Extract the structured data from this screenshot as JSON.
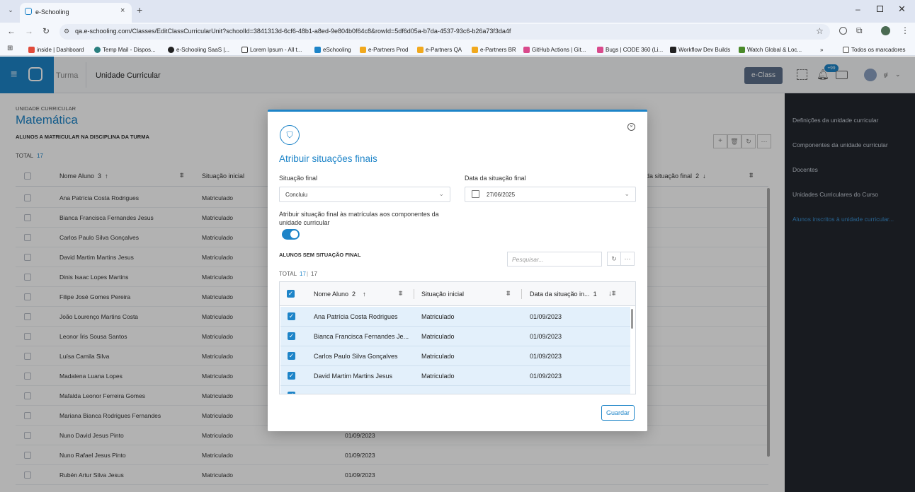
{
  "browser": {
    "tab_title": "e-Schooling",
    "url": "qa.e-schooling.com/Classes/EditClassCurricularUnit?schoolId=3841313d-6cf6-48b1-a8ed-9e804b0f64c8&rowId=5df6d05a-b7da-4537-93c6-b26a73f3da4f",
    "bookmarks": [
      "inside | Dashboard",
      "Temp Mail - Dispos...",
      "e-Schooling SaaS |...",
      "Lorem Ipsum - All t...",
      "eSchooling",
      "e-Partners Prod",
      "e-Partners QA",
      "e-Partners BR",
      "GitHub Actions | Git...",
      "Bugs | CODE 360 (Li...",
      "Workflow Dev Builds",
      "Watch Global & Loc..."
    ],
    "bookmarks_more": "»",
    "all_bookmarks": "Todos os marcadores"
  },
  "header": {
    "breadcrumb_1": "Turma",
    "breadcrumb_2": "Unidade Curricular",
    "eclass_button": "e-Class",
    "notif_badge": "+99",
    "user_initials": "gl"
  },
  "page": {
    "section_label": "UNIDADE CURRICULAR",
    "title": "Matemática",
    "subtitle": "ALUNOS A MATRICULAR NA DISCIPLINA DA TURMA",
    "total_label": "TOTAL",
    "total_value": "17",
    "col_name": "Nome Aluno",
    "col_name_order": "3",
    "col_situation": "Situação inicial",
    "col_date": "da situação final",
    "col_date_order": "2",
    "rows": [
      {
        "name": "Ana Patrícia Costa Rodrigues",
        "situation": "Matriculado",
        "date": ""
      },
      {
        "name": "Bianca Francisca Fernandes Jesus",
        "situation": "Matriculado",
        "date": ""
      },
      {
        "name": "Carlos Paulo Silva Gonçalves",
        "situation": "Matriculado",
        "date": ""
      },
      {
        "name": "David Martim Martins Jesus",
        "situation": "Matriculado",
        "date": ""
      },
      {
        "name": "Dinis Isaac Lopes Martins",
        "situation": "Matriculado",
        "date": ""
      },
      {
        "name": "Filipe José Gomes Pereira",
        "situation": "Matriculado",
        "date": ""
      },
      {
        "name": "João Lourenço Martins Costa",
        "situation": "Matriculado",
        "date": ""
      },
      {
        "name": "Leonor Íris Sousa Santos",
        "situation": "Matriculado",
        "date": ""
      },
      {
        "name": "Luísa Camila Silva",
        "situation": "Matriculado",
        "date": ""
      },
      {
        "name": "Madalena Luana Lopes",
        "situation": "Matriculado",
        "date": ""
      },
      {
        "name": "Mafalda Leonor Ferreira Gomes",
        "situation": "Matriculado",
        "date": ""
      },
      {
        "name": "Mariana Bianca Rodrigues Fernandes",
        "situation": "Matriculado",
        "date": ""
      },
      {
        "name": "Nuno David Jesus Pinto",
        "situation": "Matriculado",
        "date": "01/09/2023"
      },
      {
        "name": "Nuno Rafael Jesus Pinto",
        "situation": "Matriculado",
        "date": "01/09/2023"
      },
      {
        "name": "Rubén Artur Silva Jesus",
        "situation": "Matriculado",
        "date": "01/09/2023"
      }
    ]
  },
  "right_panel": {
    "items": [
      "Definições da unidade curricular",
      "Componentes da unidade curricular",
      "Docentes",
      "Unidades Curriculares do Curso",
      "Alunos inscritos à unidade curricular..."
    ]
  },
  "modal": {
    "title": "Atribuir situações finais",
    "situation_label": "Situação final",
    "situation_value": "Concluiu",
    "date_label": "Data da situação final",
    "date_value": "27/06/2025",
    "toggle_label": "Atribuir situação final às matrículas aos componentes da unidade curricular",
    "toggle_on": true,
    "list_label": "ALUNOS SEM SITUAÇÃO FINAL",
    "search_placeholder": "Pesquisar...",
    "total_label": "TOTAL",
    "total_selected": "17",
    "total_all": "17",
    "col_name": "Nome Aluno",
    "col_name_order": "2",
    "col_situation": "Situação inicial",
    "col_date": "Data da situação in...",
    "col_date_order": "1",
    "rows": [
      {
        "name": "Ana Patrícia Costa Rodrigues",
        "situation": "Matriculado",
        "date": "01/09/2023"
      },
      {
        "name": "Bianca Francisca Fernandes Je...",
        "situation": "Matriculado",
        "date": "01/09/2023"
      },
      {
        "name": "Carlos Paulo Silva Gonçalves",
        "situation": "Matriculado",
        "date": "01/09/2023"
      },
      {
        "name": "David Martim Martins Jesus",
        "situation": "Matriculado",
        "date": "01/09/2023"
      }
    ],
    "save_button": "Guardar"
  },
  "colors": {
    "accent": "#1d84c8",
    "dark_panel": "#23272e"
  }
}
